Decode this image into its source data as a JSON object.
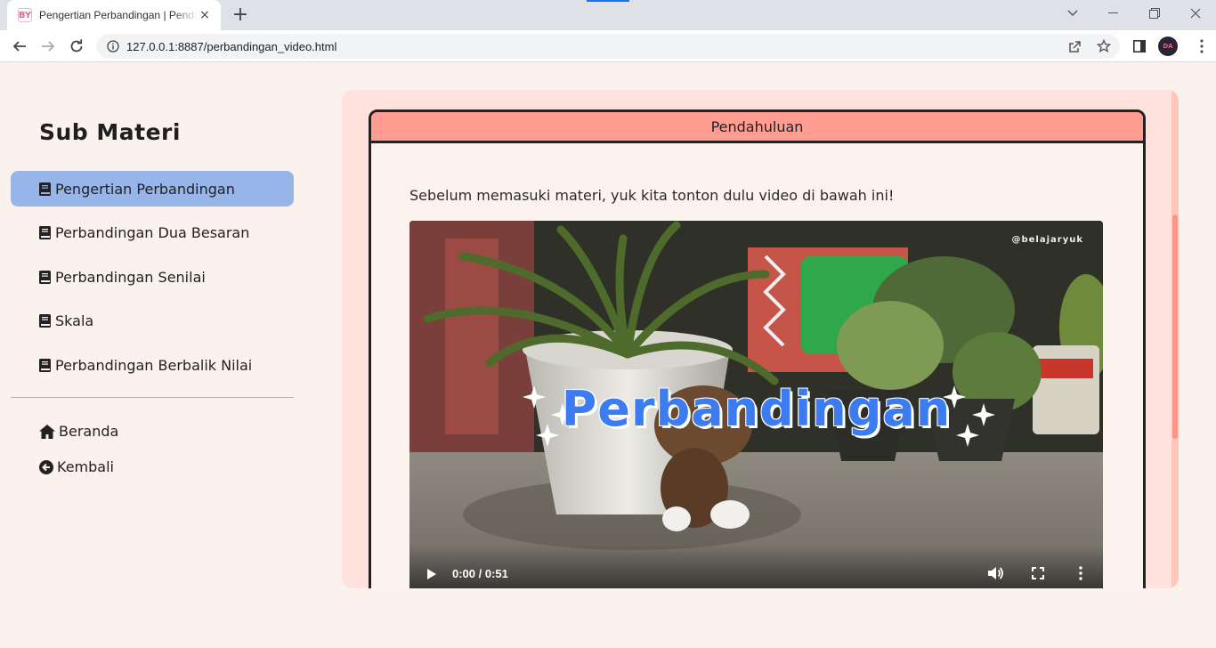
{
  "browser": {
    "tab_title": "Pengertian Perbandingan | Pendahuluan",
    "tab_favicon_text": "BY",
    "close_tab": "×",
    "new_tab": "+",
    "url": "127.0.0.1:8887/perbandingan_video.html",
    "profile_initials": "DA"
  },
  "sidebar": {
    "title": "Sub Materi",
    "items": [
      {
        "label": "Pengertian Perbandingan",
        "active": true
      },
      {
        "label": "Perbandingan Dua Besaran",
        "active": false
      },
      {
        "label": "Perbandingan Senilai",
        "active": false
      },
      {
        "label": "Skala",
        "active": false
      },
      {
        "label": "Perbandingan Berbalik Nilai",
        "active": false
      }
    ],
    "links": [
      {
        "label": "Beranda",
        "icon": "home-icon"
      },
      {
        "label": "Kembali",
        "icon": "arrow-circle-left-icon"
      }
    ]
  },
  "content": {
    "header": "Pendahuluan",
    "intro": "Sebelum memasuki materi, yuk kita tonton dulu video di bawah ini!",
    "video": {
      "title_overlay": "Perbandingan",
      "watermark": "@belajaryuk",
      "time": "0:00 / 0:51"
    }
  },
  "colors": {
    "page_bg": "#fbf2ed",
    "active_item": "#98b5ea",
    "panel_bg": "#ffe1dd",
    "card_header": "#ff9d93",
    "video_title": "#3d7cf0"
  }
}
